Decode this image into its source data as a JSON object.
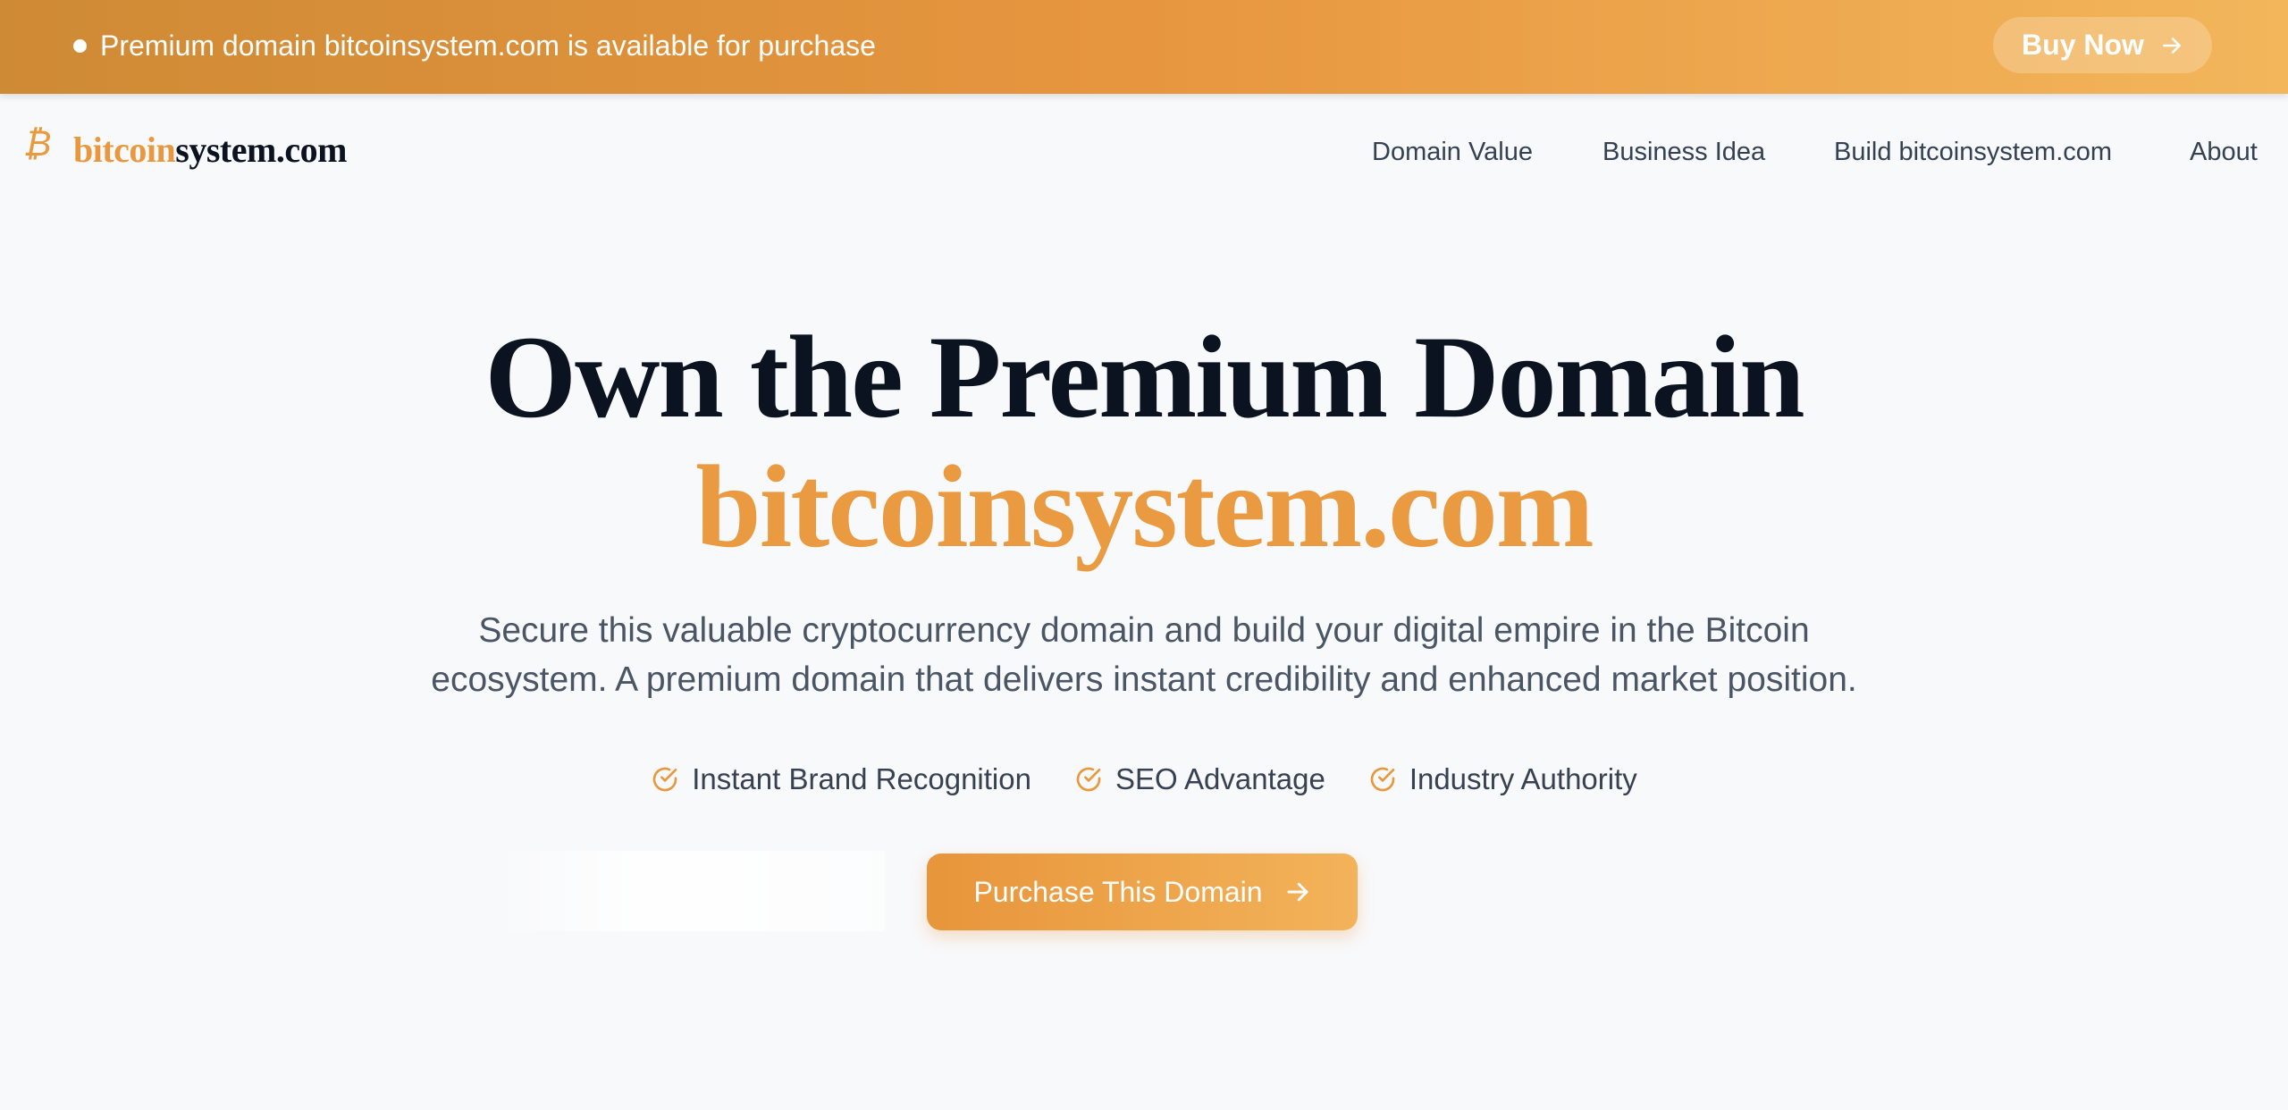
{
  "topbar": {
    "message": "Premium domain bitcoinsystem.com is available for purchase",
    "buy_label": "Buy Now"
  },
  "logo": {
    "part1": "bitcoin",
    "part2": "system.com",
    "icon": "bitcoin-icon"
  },
  "nav": {
    "items": [
      {
        "label": "Domain Value"
      },
      {
        "label": "Business Idea"
      },
      {
        "label": "Build bitcoinsystem.com"
      },
      {
        "label": "About"
      }
    ]
  },
  "hero": {
    "title_line1": "Own the Premium Domain",
    "title_line2": "bitcoinsystem.com",
    "subtitle_line1": "Secure this valuable cryptocurrency domain and build your digital empire in the Bitcoin",
    "subtitle_line2": "ecosystem. A premium domain that delivers instant credibility and enhanced market position.",
    "features": [
      {
        "label": "Instant Brand Recognition",
        "icon": "check-circle-icon"
      },
      {
        "label": "SEO Advantage",
        "icon": "check-circle-icon"
      },
      {
        "label": "Industry Authority",
        "icon": "check-circle-icon"
      }
    ],
    "cta_label": "Purchase This Domain"
  },
  "colors": {
    "accent": "#e9983f",
    "accent_light": "#f3b35a",
    "heading": "#0b1220",
    "body_text": "#4a5565",
    "background": "#f8f9fb"
  }
}
